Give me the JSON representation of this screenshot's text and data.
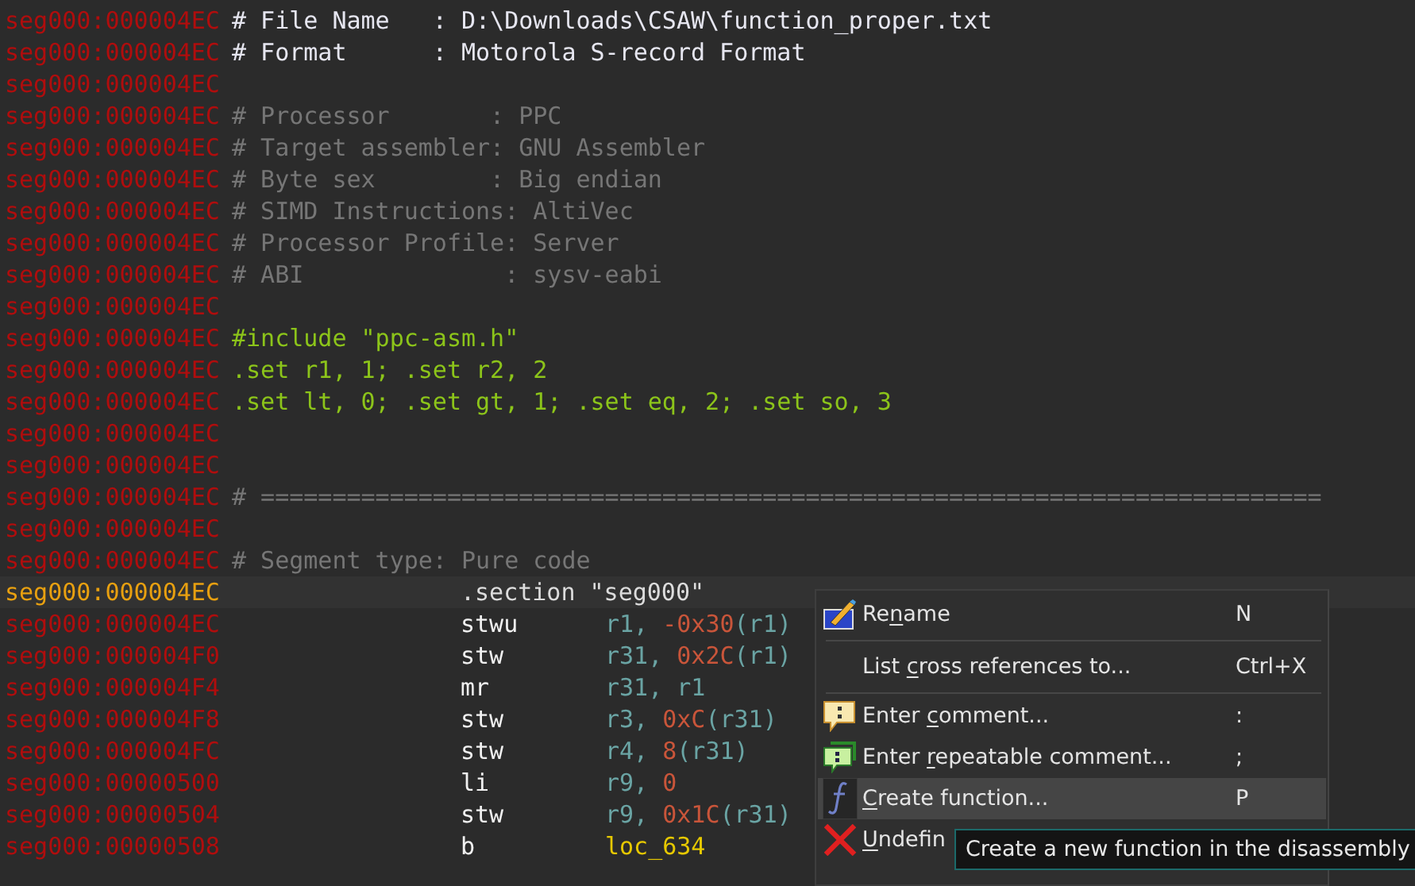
{
  "listing": {
    "lines": [
      {
        "address": "seg000:000004EC",
        "kind": "header",
        "text": "# File Name   : D:\\Downloads\\CSAW\\function_proper.txt",
        "current": false
      },
      {
        "address": "seg000:000004EC",
        "kind": "header",
        "text": "# Format      : Motorola S-record Format",
        "current": false
      },
      {
        "address": "seg000:000004EC",
        "kind": "blank",
        "current": false
      },
      {
        "address": "seg000:000004EC",
        "kind": "comment",
        "text": "# Processor       : PPC",
        "current": false
      },
      {
        "address": "seg000:000004EC",
        "kind": "comment",
        "text": "# Target assembler: GNU Assembler",
        "current": false
      },
      {
        "address": "seg000:000004EC",
        "kind": "comment",
        "text": "# Byte sex        : Big endian",
        "current": false
      },
      {
        "address": "seg000:000004EC",
        "kind": "comment",
        "text": "# SIMD Instructions: AltiVec",
        "current": false
      },
      {
        "address": "seg000:000004EC",
        "kind": "comment",
        "text": "# Processor Profile: Server",
        "current": false
      },
      {
        "address": "seg000:000004EC",
        "kind": "comment",
        "text": "# ABI              : sysv-eabi",
        "current": false
      },
      {
        "address": "seg000:000004EC",
        "kind": "blank",
        "current": false
      },
      {
        "address": "seg000:000004EC",
        "kind": "directive",
        "text": "#include \"ppc-asm.h\"",
        "current": false
      },
      {
        "address": "seg000:000004EC",
        "kind": "directive",
        "text": ".set r1, 1; .set r2, 2",
        "current": false
      },
      {
        "address": "seg000:000004EC",
        "kind": "directive",
        "text": ".set lt, 0; .set gt, 1; .set eq, 2; .set so, 3",
        "current": false
      },
      {
        "address": "seg000:000004EC",
        "kind": "blank",
        "current": false
      },
      {
        "address": "seg000:000004EC",
        "kind": "blank",
        "current": false
      },
      {
        "address": "seg000:000004EC",
        "kind": "comment",
        "text": "# ==========================================================================",
        "current": false
      },
      {
        "address": "seg000:000004EC",
        "kind": "blank",
        "current": false
      },
      {
        "address": "seg000:000004EC",
        "kind": "comment",
        "text": "# Segment type: Pure code",
        "current": false
      },
      {
        "address": "seg000:000004EC",
        "kind": "section",
        "text": ".section \"seg000\"",
        "current": true
      },
      {
        "address": "seg000:000004EC",
        "kind": "instruction",
        "mnemonic": "stwu",
        "operands": [
          {
            "kind": "reg",
            "text": "r1, "
          },
          {
            "kind": "num",
            "text": "-0x30"
          },
          {
            "kind": "reg",
            "text": "(r1)"
          }
        ],
        "current": false
      },
      {
        "address": "seg000:000004F0",
        "kind": "instruction",
        "mnemonic": "stw",
        "operands": [
          {
            "kind": "reg",
            "text": "r31, "
          },
          {
            "kind": "num",
            "text": "0x2C"
          },
          {
            "kind": "reg",
            "text": "(r1)"
          }
        ],
        "current": false
      },
      {
        "address": "seg000:000004F4",
        "kind": "instruction",
        "mnemonic": "mr",
        "operands": [
          {
            "kind": "reg",
            "text": "r31, r1"
          }
        ],
        "current": false
      },
      {
        "address": "seg000:000004F8",
        "kind": "instruction",
        "mnemonic": "stw",
        "operands": [
          {
            "kind": "reg",
            "text": "r3, "
          },
          {
            "kind": "num",
            "text": "0xC"
          },
          {
            "kind": "reg",
            "text": "(r31)"
          }
        ],
        "current": false
      },
      {
        "address": "seg000:000004FC",
        "kind": "instruction",
        "mnemonic": "stw",
        "operands": [
          {
            "kind": "reg",
            "text": "r4, "
          },
          {
            "kind": "num",
            "text": "8"
          },
          {
            "kind": "reg",
            "text": "(r31)"
          }
        ],
        "current": false
      },
      {
        "address": "seg000:00000500",
        "kind": "instruction",
        "mnemonic": "li",
        "operands": [
          {
            "kind": "reg",
            "text": "r9, "
          },
          {
            "kind": "num",
            "text": "0"
          }
        ],
        "current": false
      },
      {
        "address": "seg000:00000504",
        "kind": "instruction",
        "mnemonic": "stw",
        "operands": [
          {
            "kind": "reg",
            "text": "r9, "
          },
          {
            "kind": "num",
            "text": "0x1C"
          },
          {
            "kind": "reg",
            "text": "(r31)"
          }
        ],
        "current": false
      },
      {
        "address": "seg000:00000508",
        "kind": "instruction",
        "mnemonic": "b",
        "operands": [
          {
            "kind": "name",
            "text": "loc_634"
          }
        ],
        "current": false
      }
    ]
  },
  "context_menu": {
    "items": [
      {
        "kind": "rename",
        "before": "Re",
        "accel": "n",
        "after": "ame",
        "shortcut": "N",
        "selected": false,
        "separator_after": true
      },
      {
        "kind": "plain",
        "before": "List ",
        "accel": "c",
        "after": "ross references to...",
        "shortcut": "Ctrl+X",
        "selected": false,
        "separator_after": true
      },
      {
        "kind": "comment",
        "before": "Enter ",
        "accel": "c",
        "after": "omment...",
        "shortcut": ":",
        "selected": false,
        "separator_after": false
      },
      {
        "kind": "repeatable",
        "before": "Enter ",
        "accel": "r",
        "after": "epeatable comment...",
        "shortcut": ";",
        "selected": false,
        "separator_after": false
      },
      {
        "kind": "function",
        "accel": "C",
        "after": "reate function...",
        "shortcut": "P",
        "selected": true,
        "separator_after": false
      },
      {
        "kind": "undefine",
        "accel": "U",
        "after": "ndefin",
        "selected": false,
        "separator_after": false
      }
    ]
  },
  "tooltip": {
    "text": "Create a new function in the disassembly"
  }
}
